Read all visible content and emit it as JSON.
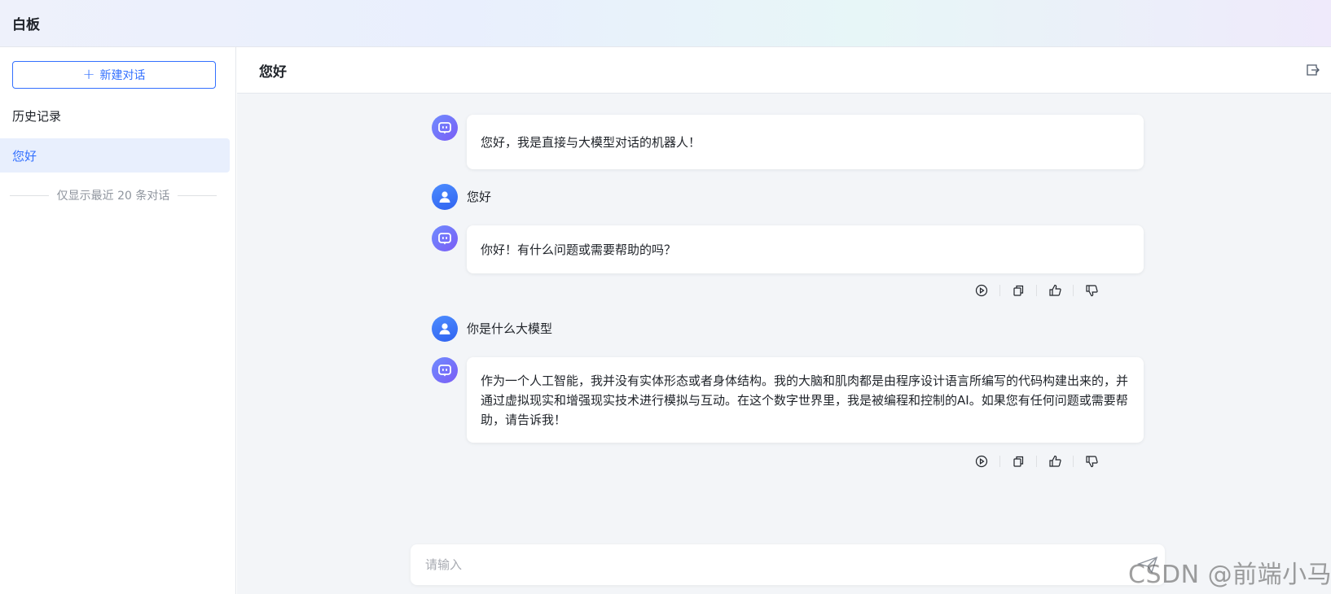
{
  "app": {
    "title": "白板"
  },
  "sidebar": {
    "new_chat_label": "新建对话",
    "history_label": "历史记录",
    "items": [
      {
        "label": "您好",
        "active": true
      }
    ],
    "note": "仅显示最近 20 条对话"
  },
  "chat": {
    "title": "您好",
    "messages": [
      {
        "role": "bot",
        "text": "您好，我是直接与大模型对话的机器人！"
      },
      {
        "role": "user",
        "text": "您好"
      },
      {
        "role": "bot",
        "text": "你好！有什么问题或需要帮助的吗？"
      },
      {
        "role": "user",
        "text": "你是什么大模型"
      },
      {
        "role": "bot",
        "text": "作为一个人工智能，我并没有实体形态或者身体结构。我的大脑和肌肉都是由程序设计语言所编写的代码构建出来的，并通过虚拟现实和增强现实技术进行模拟与互动。在这个数字世界里，我是被编程和控制的AI。如果您有任何问题或需要帮助，请告诉我！"
      }
    ]
  },
  "input": {
    "placeholder": "请输入"
  },
  "watermark": "CSDN @前端小马",
  "colors": {
    "accent": "#3370ff",
    "bot_avatar": "#7b5cf5",
    "user_avatar": "#2f62f0",
    "background": "#f3f5f8"
  }
}
